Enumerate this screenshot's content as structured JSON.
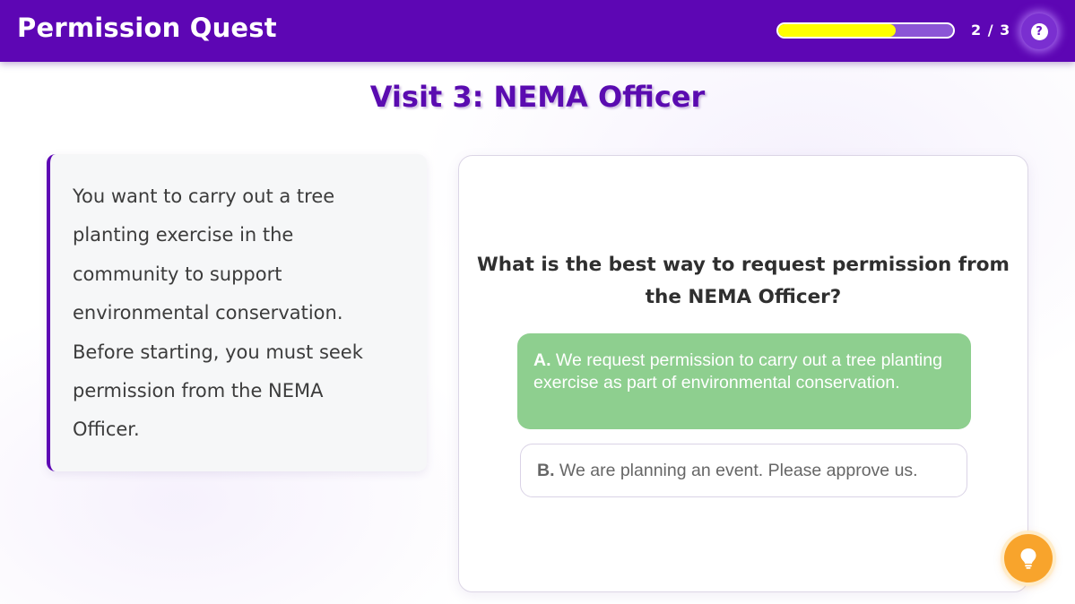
{
  "header": {
    "title": "Permission Quest",
    "progress_text": "2 / 3",
    "progress_fraction": 0.67,
    "help_icon": "question-circle-icon"
  },
  "visit": {
    "title": "Visit 3: NEMA Officer"
  },
  "scenario": {
    "text": "You want to carry out a tree planting exercise in the community to support environmental conservation. Before starting, you must seek permission from the NEMA Officer."
  },
  "question": {
    "text": "What is the best way to request permission from the NEMA Officer?",
    "options": [
      {
        "letter": "A.",
        "text": "We request permission to carry out a tree planting exercise as part of environmental conservation.",
        "state": "selected-correct"
      },
      {
        "letter": "B.",
        "text": "We are planning an event. Please approve us.",
        "state": "unselected"
      }
    ]
  },
  "hint": {
    "icon": "lightbulb-icon"
  },
  "colors": {
    "header_bg": "#5d06b4",
    "progress_fill": "#ffff00",
    "title_purple": "#5a0bb0",
    "correct_green": "#8ecf8f",
    "hint_orange": "#f8a42c"
  }
}
